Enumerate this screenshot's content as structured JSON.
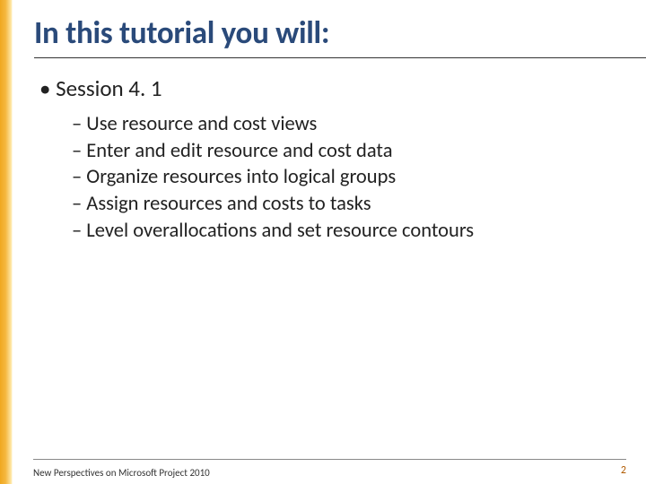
{
  "title": "In this tutorial you will:",
  "session_label": "Session 4. 1",
  "items": [
    "Use resource and cost views",
    "Enter and edit resource and cost data",
    "Organize resources into logical groups",
    "Assign resources and costs to tasks",
    "Level overallocations and set resource contours"
  ],
  "footer_text": "New Perspectives on Microsoft Project 2010",
  "page_number": "2",
  "colors": {
    "title_color": "#2a4a7a",
    "accent_gradient_start": "#f0a820",
    "accent_gradient_end": "#ffe8a8",
    "page_number_color": "#b05a00"
  }
}
